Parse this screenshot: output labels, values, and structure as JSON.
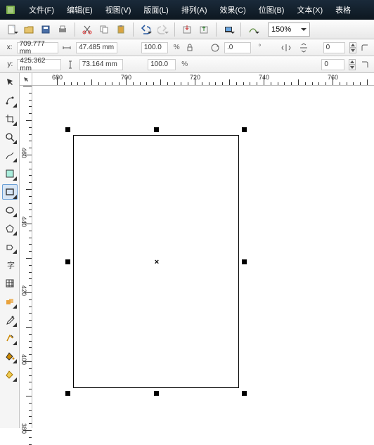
{
  "menu": {
    "items": [
      "文件(F)",
      "编辑(E)",
      "视图(V)",
      "版面(L)",
      "排列(A)",
      "效果(C)",
      "位图(B)",
      "文本(X)",
      "表格"
    ]
  },
  "toolbar1": {
    "zoom": "150%"
  },
  "coords": {
    "x_label": "x:",
    "x": "709.777 mm",
    "y_label": "y:",
    "y": "425.362 mm",
    "w": "47.485 mm",
    "h": "73.164 mm",
    "sx": "100.0",
    "sy": "100.0",
    "rot": ".0",
    "deg": "°",
    "pctA": "%",
    "pctB": "%",
    "v0": "0",
    "v1": "0"
  },
  "ruler": {
    "h": [
      "680",
      "700",
      "720",
      "740",
      "760"
    ],
    "v": [
      "460",
      "440",
      "420",
      "400",
      "380"
    ]
  },
  "icons": {
    "app": "cd",
    "new": "new",
    "open": "open",
    "save": "save",
    "print": "print",
    "cut": "cut",
    "copy": "copy",
    "paste": "paste",
    "undo": "undo",
    "redo": "redo",
    "import": "import",
    "export": "export",
    "fill": "fill",
    "hatch": "hatch",
    "lock": "lock",
    "rot": "rot",
    "mirh": "mirh",
    "mirv": "mirv"
  }
}
